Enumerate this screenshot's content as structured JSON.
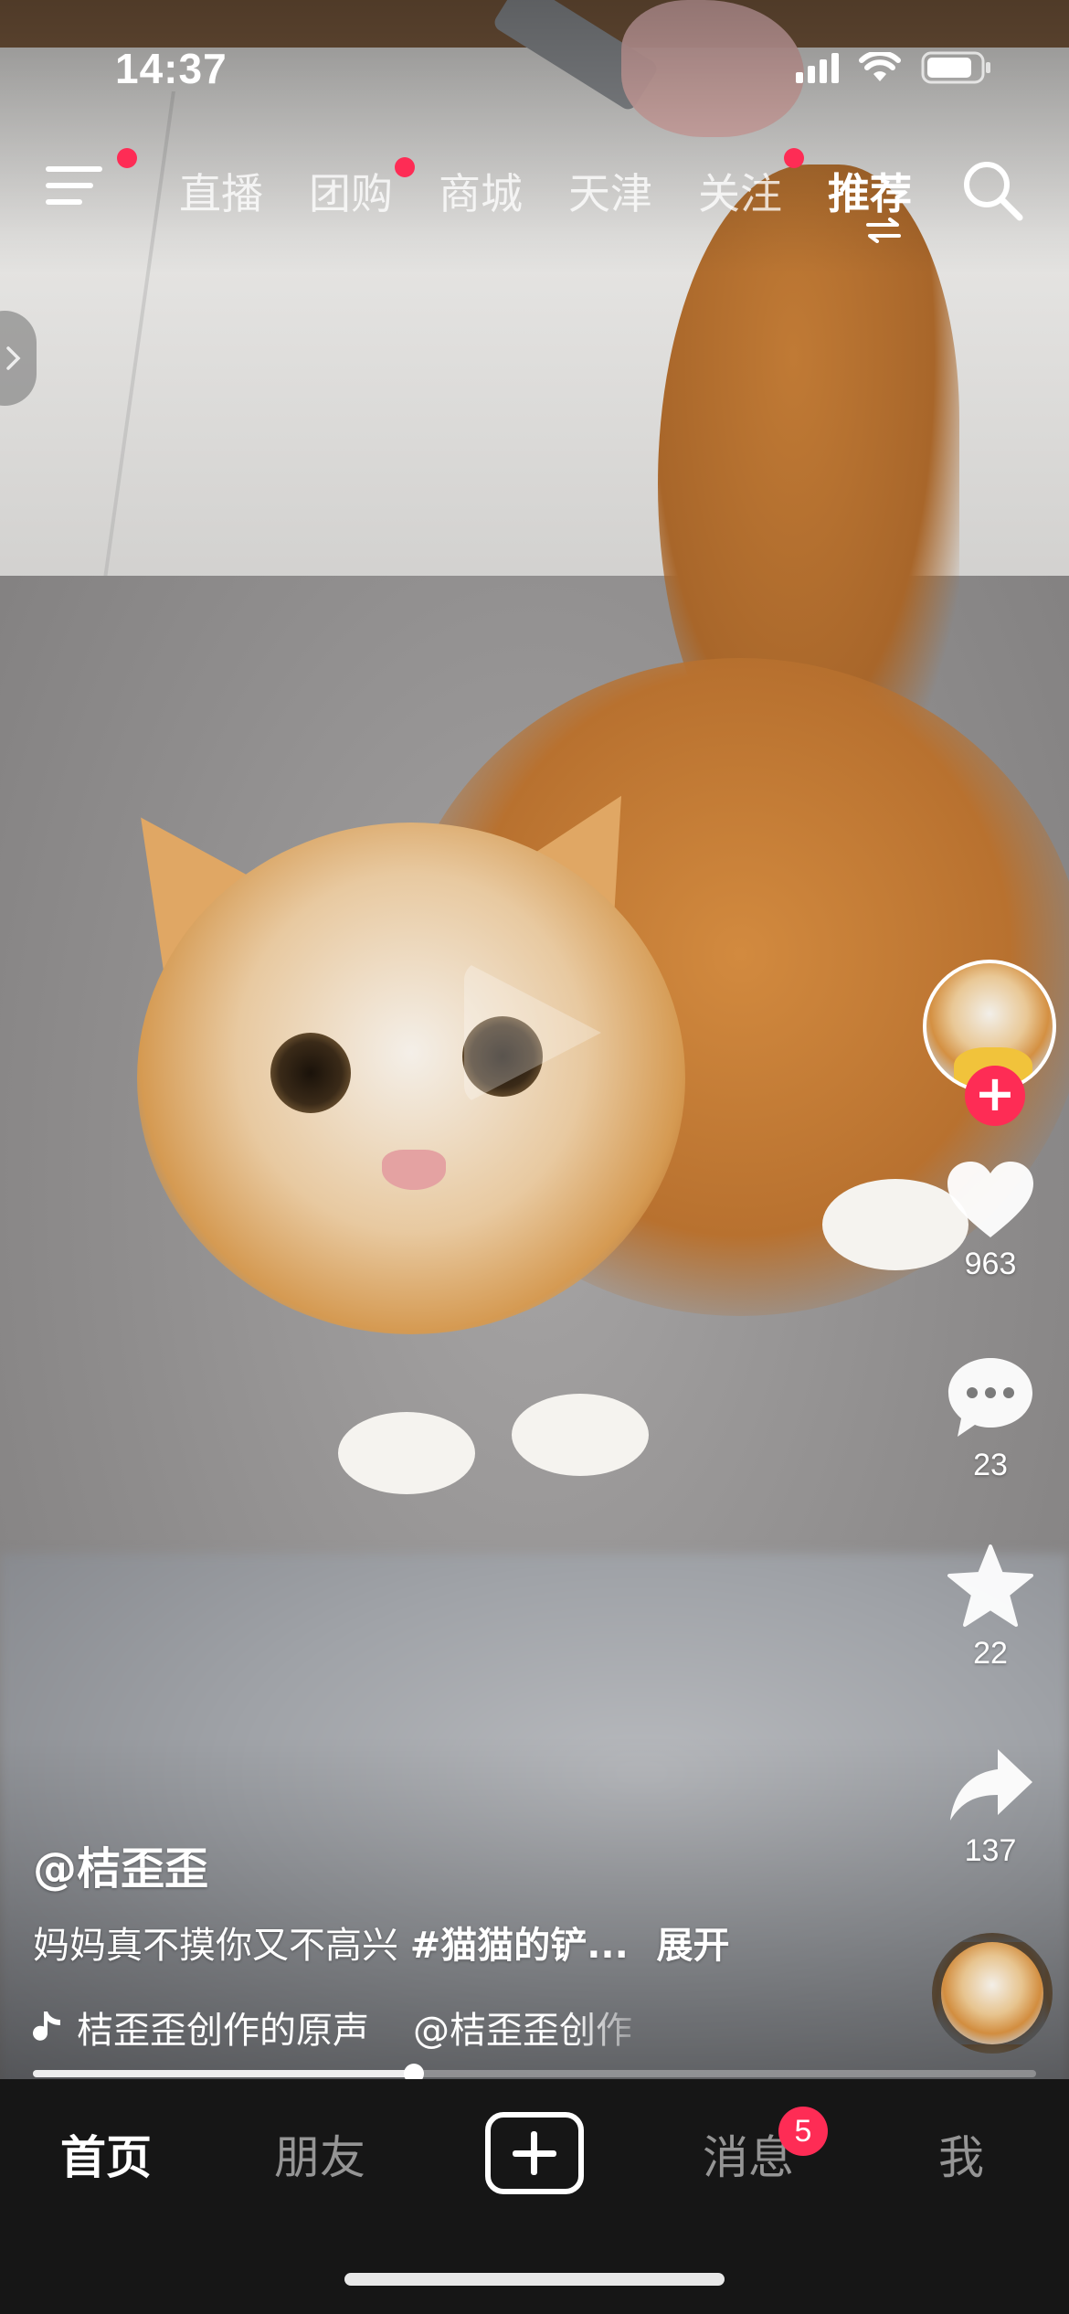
{
  "status_bar": {
    "time": "14:37"
  },
  "top_nav": {
    "tabs": [
      {
        "label": "直播",
        "dot": false
      },
      {
        "label": "团购",
        "dot": true
      },
      {
        "label": "商城",
        "dot": false
      },
      {
        "label": "天津",
        "dot": false
      },
      {
        "label": "关注",
        "dot": true
      },
      {
        "label": "推荐",
        "dot": false,
        "active": true
      }
    ],
    "menu_has_dot": true
  },
  "actions": {
    "likes": "963",
    "comments": "23",
    "favorites": "22",
    "shares": "137",
    "follow_symbol": "+"
  },
  "caption": {
    "author": "@桔歪歪",
    "description": "妈妈真不摸你又不高兴",
    "hashtag": "#猫猫的铲...",
    "expand": "展开",
    "music_title": "桔歪歪创作的原声",
    "music_author": "@桔歪歪创作"
  },
  "playback": {
    "progress": 0.38
  },
  "tabbar": {
    "home": "首页",
    "friends": "朋友",
    "messages": "消息",
    "messages_badge": "5",
    "me": "我"
  },
  "colors": {
    "accent": "#fe2c55",
    "tabbar_bg": "#161616"
  }
}
